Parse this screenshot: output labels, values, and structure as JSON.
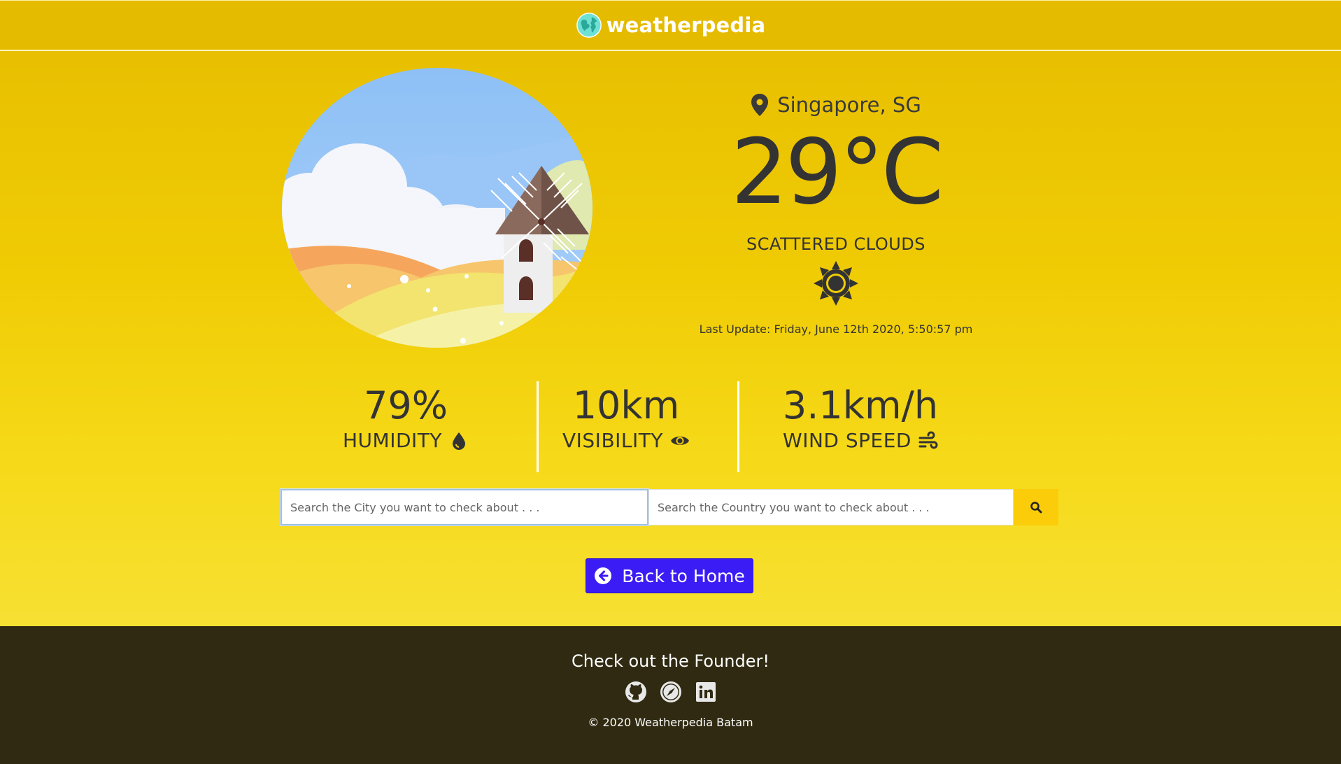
{
  "navbar": {
    "brand_name": "weatherpedia",
    "logo_icon": "globe-icon"
  },
  "weather": {
    "location": "Singapore, SG",
    "temperature": "29°C",
    "condition": "SCATTERED CLOUDS",
    "condition_icon": "sun-icon",
    "last_update": "Last Update: Friday, June 12th 2020, 5:50:57 pm"
  },
  "stats": {
    "humidity": {
      "value": "79%",
      "label": "HUMIDITY",
      "icon": "droplet-icon"
    },
    "visibility": {
      "value": "10km",
      "label": "VISIBILITY",
      "icon": "eye-icon"
    },
    "wind": {
      "value": "3.1km/h",
      "label": "WIND SPEED",
      "icon": "wind-icon"
    }
  },
  "search": {
    "city_placeholder": "Search the City you want to check about . . .",
    "country_placeholder": "Search the Country you want to check about . . .",
    "button_icon": "search-icon"
  },
  "back_button": {
    "label": "Back to Home",
    "icon": "arrow-circle-left-icon"
  },
  "footer": {
    "title": "Check out the Founder!",
    "links": [
      "github-icon",
      "compass-icon",
      "linkedin-icon"
    ],
    "copyright": "© 2020 Weatherpedia Batam"
  },
  "colors": {
    "background": "#f0cc05",
    "footer": "#2f2a11",
    "accent_button": "#3b1cf5",
    "search_button": "#fbcc0a"
  }
}
